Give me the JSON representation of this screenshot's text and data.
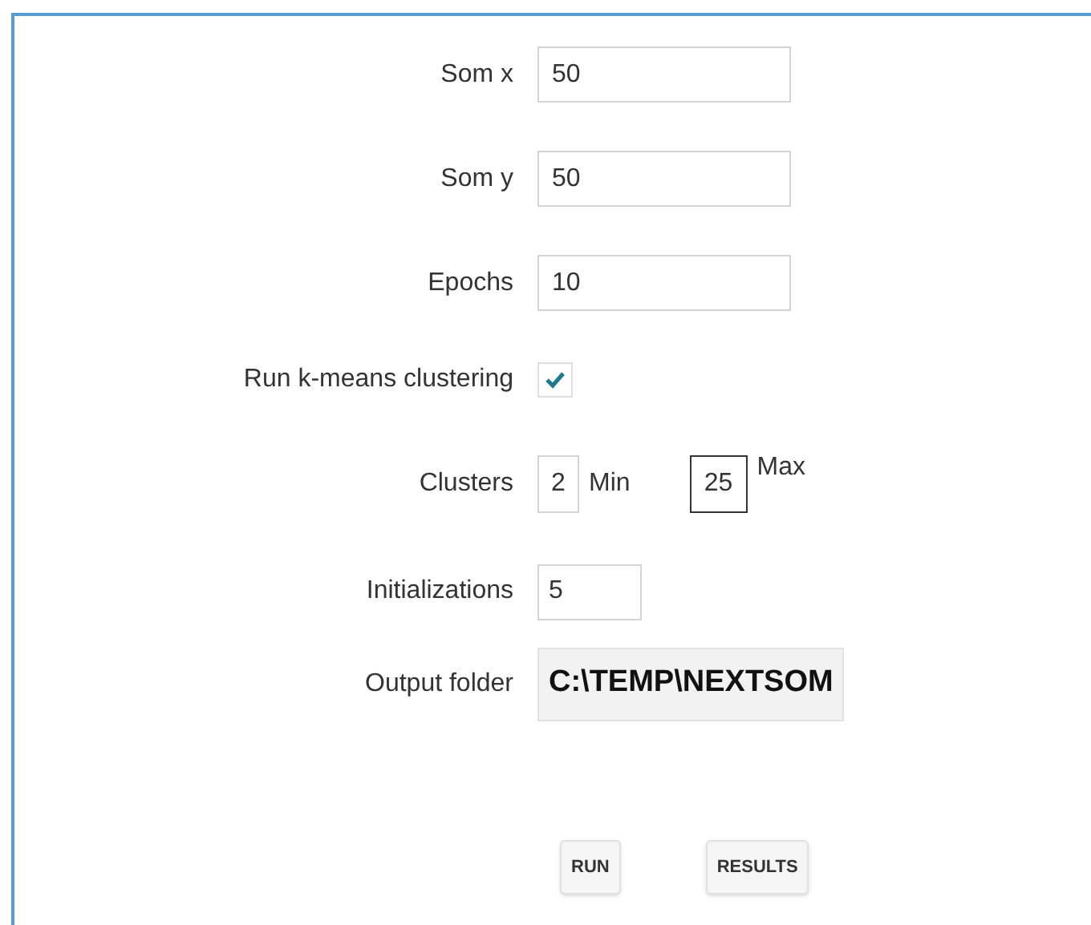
{
  "fields": [
    {
      "kind": "text",
      "label": "Som x",
      "value": "50"
    },
    {
      "kind": "text",
      "label": "Som y",
      "value": "50"
    },
    {
      "kind": "text",
      "label": "Epochs",
      "value": "10"
    },
    {
      "kind": "checkbox",
      "label": "Run k-means clustering",
      "checked": true
    },
    {
      "kind": "range",
      "label": "Clusters",
      "min_value": "2",
      "min_label": "Min",
      "max_value": "25",
      "max_label": "Max"
    },
    {
      "kind": "short",
      "label": "Initializations",
      "value": "5"
    },
    {
      "kind": "folder",
      "label": "Output folder",
      "value": "C:\\TEMP\\NEXTSOM"
    }
  ],
  "buttons": [
    "RUN",
    "RESULTS"
  ]
}
